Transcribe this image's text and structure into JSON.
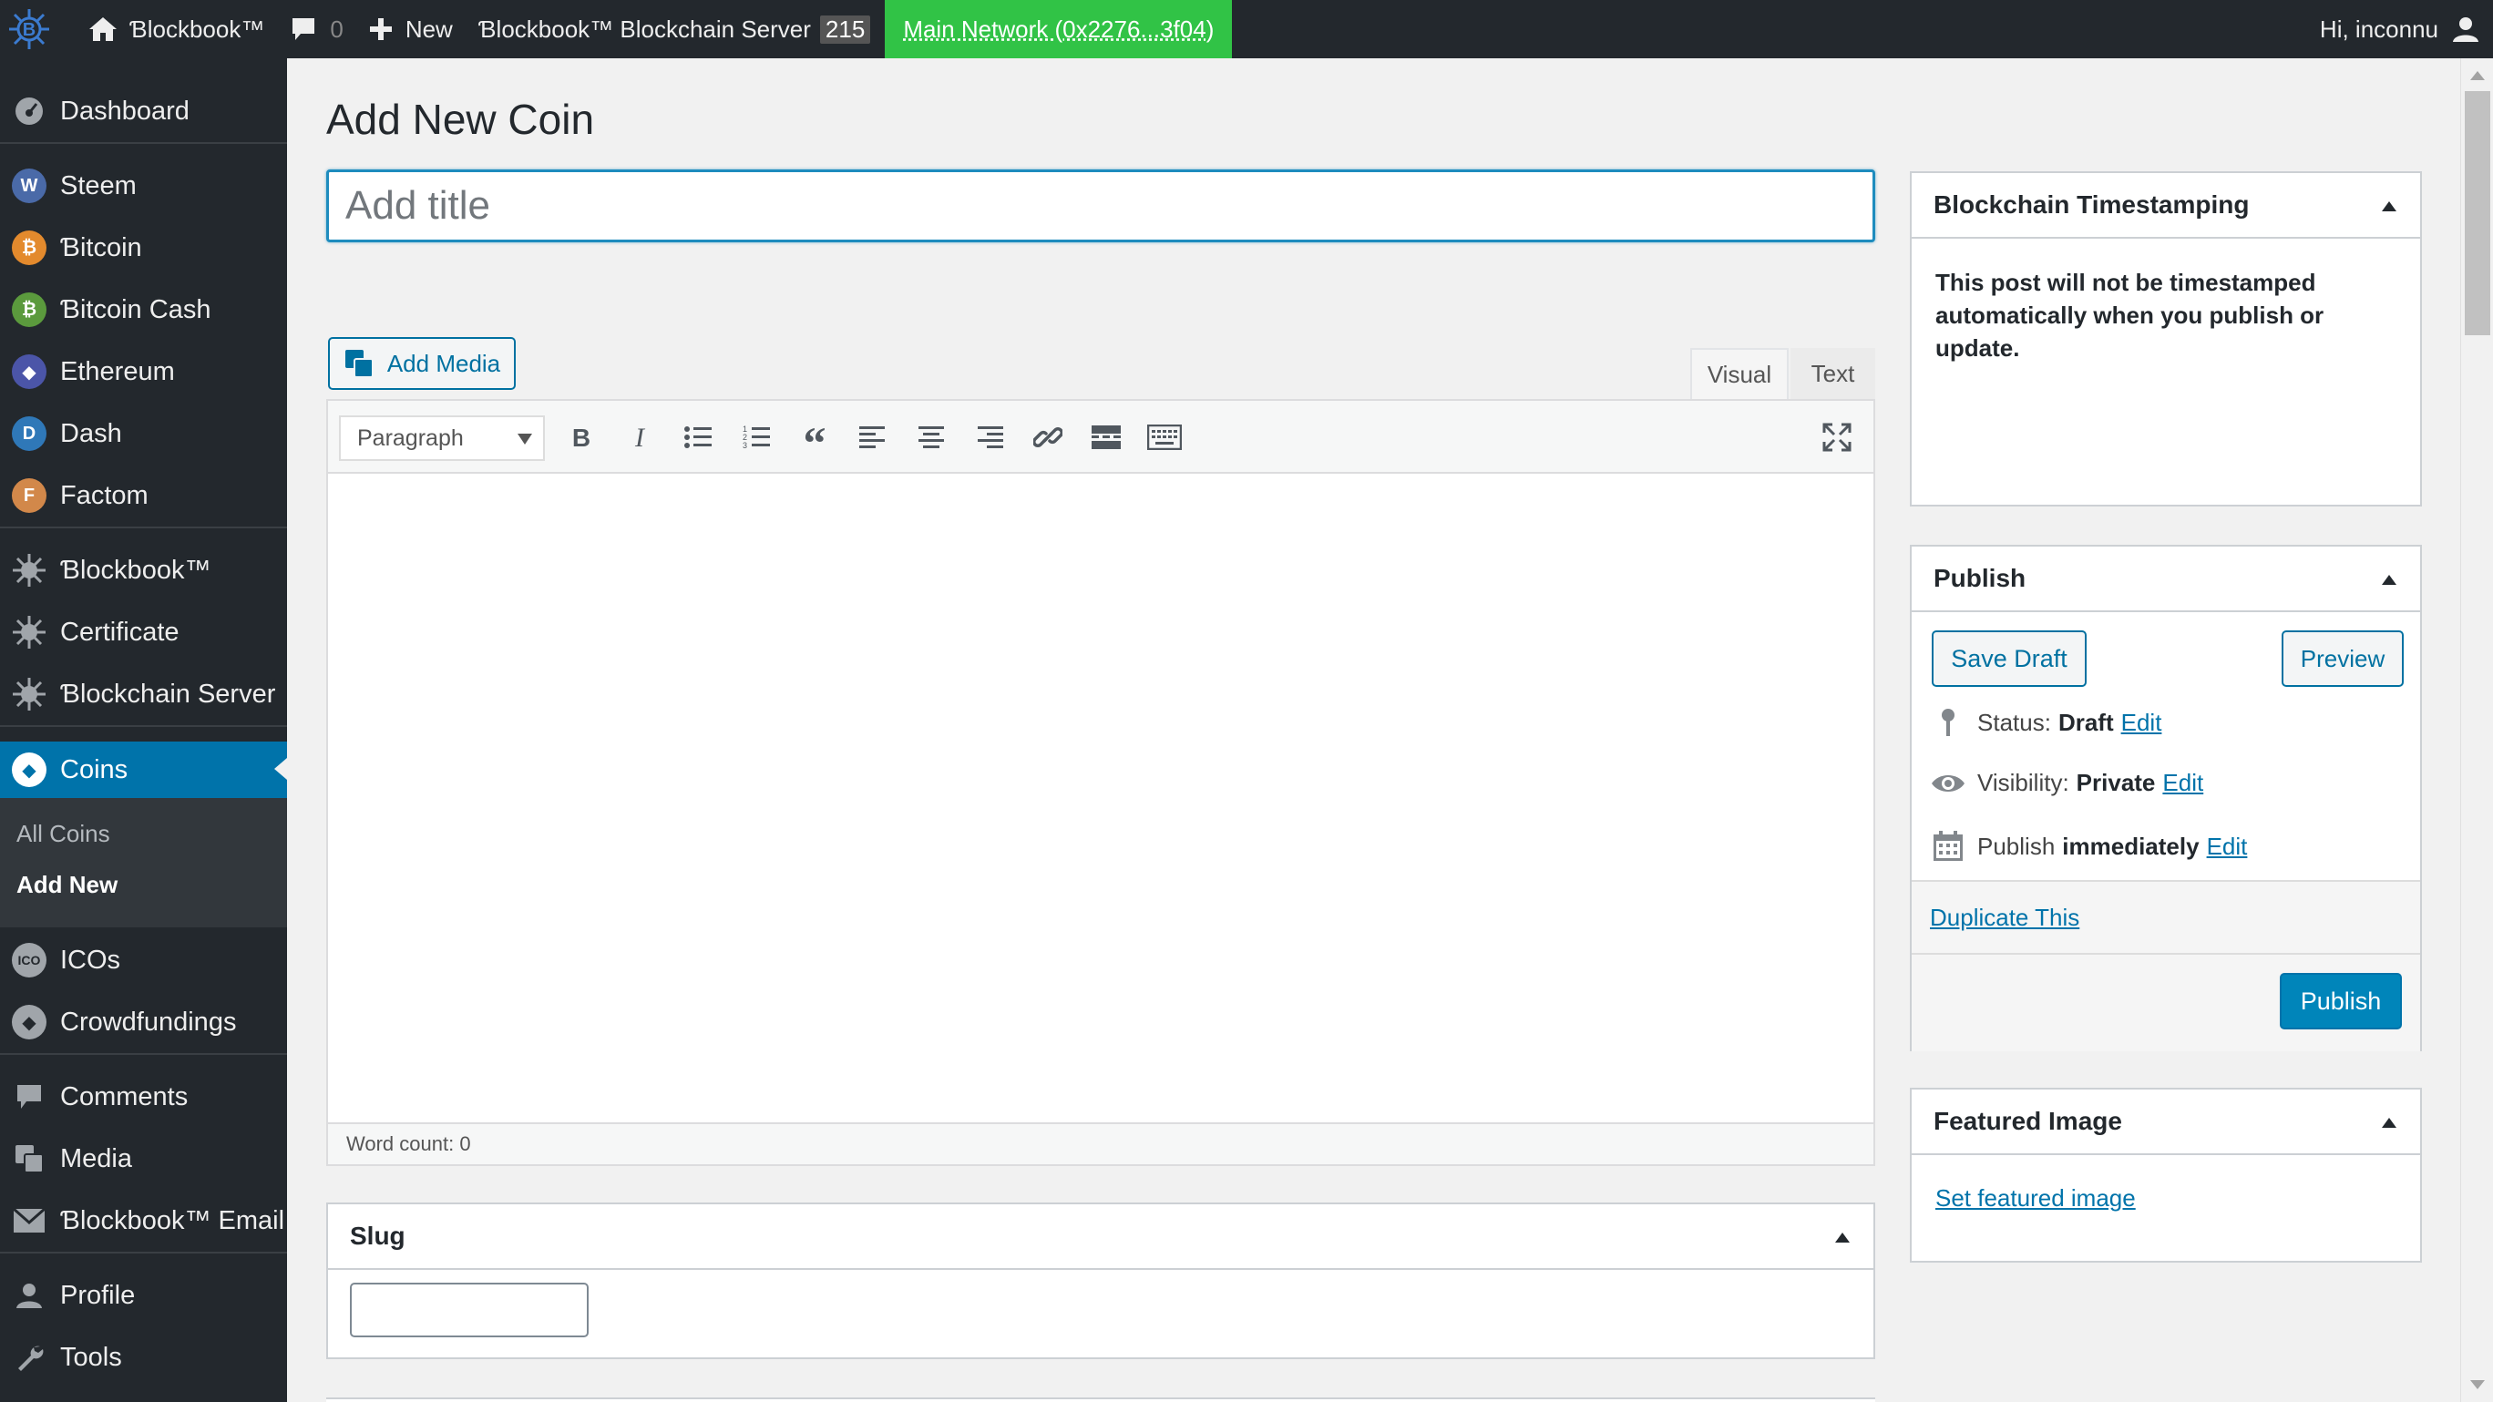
{
  "adminbar": {
    "site_name": "Ɓlockbook™",
    "comments_count": "0",
    "new_label": "New",
    "server_label": "Ɓlockbook™ Blockchain Server",
    "server_badge": "215",
    "network_label": "Main Network (0x2276...3f04)",
    "greeting": "Hi, inconnu"
  },
  "sidebar": {
    "items": [
      {
        "label": "Dashboard"
      },
      {
        "label": "Steem"
      },
      {
        "label": "Ɓitcoin"
      },
      {
        "label": "Ɓitcoin Cash"
      },
      {
        "label": "Ethereum"
      },
      {
        "label": "Dash"
      },
      {
        "label": "Factom"
      },
      {
        "label": "Ɓlockbook™"
      },
      {
        "label": "Certificate"
      },
      {
        "label": "Ɓlockchain Server"
      },
      {
        "label": "Coins"
      },
      {
        "label": "ICOs"
      },
      {
        "label": "Crowdfundings"
      },
      {
        "label": "Comments"
      },
      {
        "label": "Media"
      },
      {
        "label": "Ɓlockbook™ Email"
      },
      {
        "label": "Profile"
      },
      {
        "label": "Tools"
      }
    ],
    "submenu": [
      {
        "label": "All Coins"
      },
      {
        "label": "Add New"
      }
    ]
  },
  "main": {
    "page_title": "Add New Coin",
    "title_placeholder": "Add title",
    "add_media_label": "Add Media",
    "tab_visual": "Visual",
    "tab_text": "Text",
    "format_select": "Paragraph",
    "word_count": "Word count: 0",
    "slug_title": "Slug"
  },
  "timestamp_box": {
    "title": "Blockchain Timestamping",
    "message": "This post will not be timestamped automatically when you publish or update."
  },
  "publish_box": {
    "title": "Publish",
    "save_draft": "Save Draft",
    "preview": "Preview",
    "status_label": "Status:",
    "status_value": "Draft",
    "visibility_label": "Visibility:",
    "visibility_value": "Private",
    "publish_label": "Publish",
    "publish_value": "immediately",
    "edit_link": "Edit",
    "duplicate": "Duplicate This",
    "publish_button": "Publish"
  },
  "featured_box": {
    "title": "Featured Image",
    "set_link": "Set featured image"
  },
  "colors": {
    "adminbar_bg": "#23282d",
    "network_bg": "#31c346",
    "accent": "#0073aa",
    "current_menu": "#0073aa",
    "publish_button": "#0085ba"
  }
}
